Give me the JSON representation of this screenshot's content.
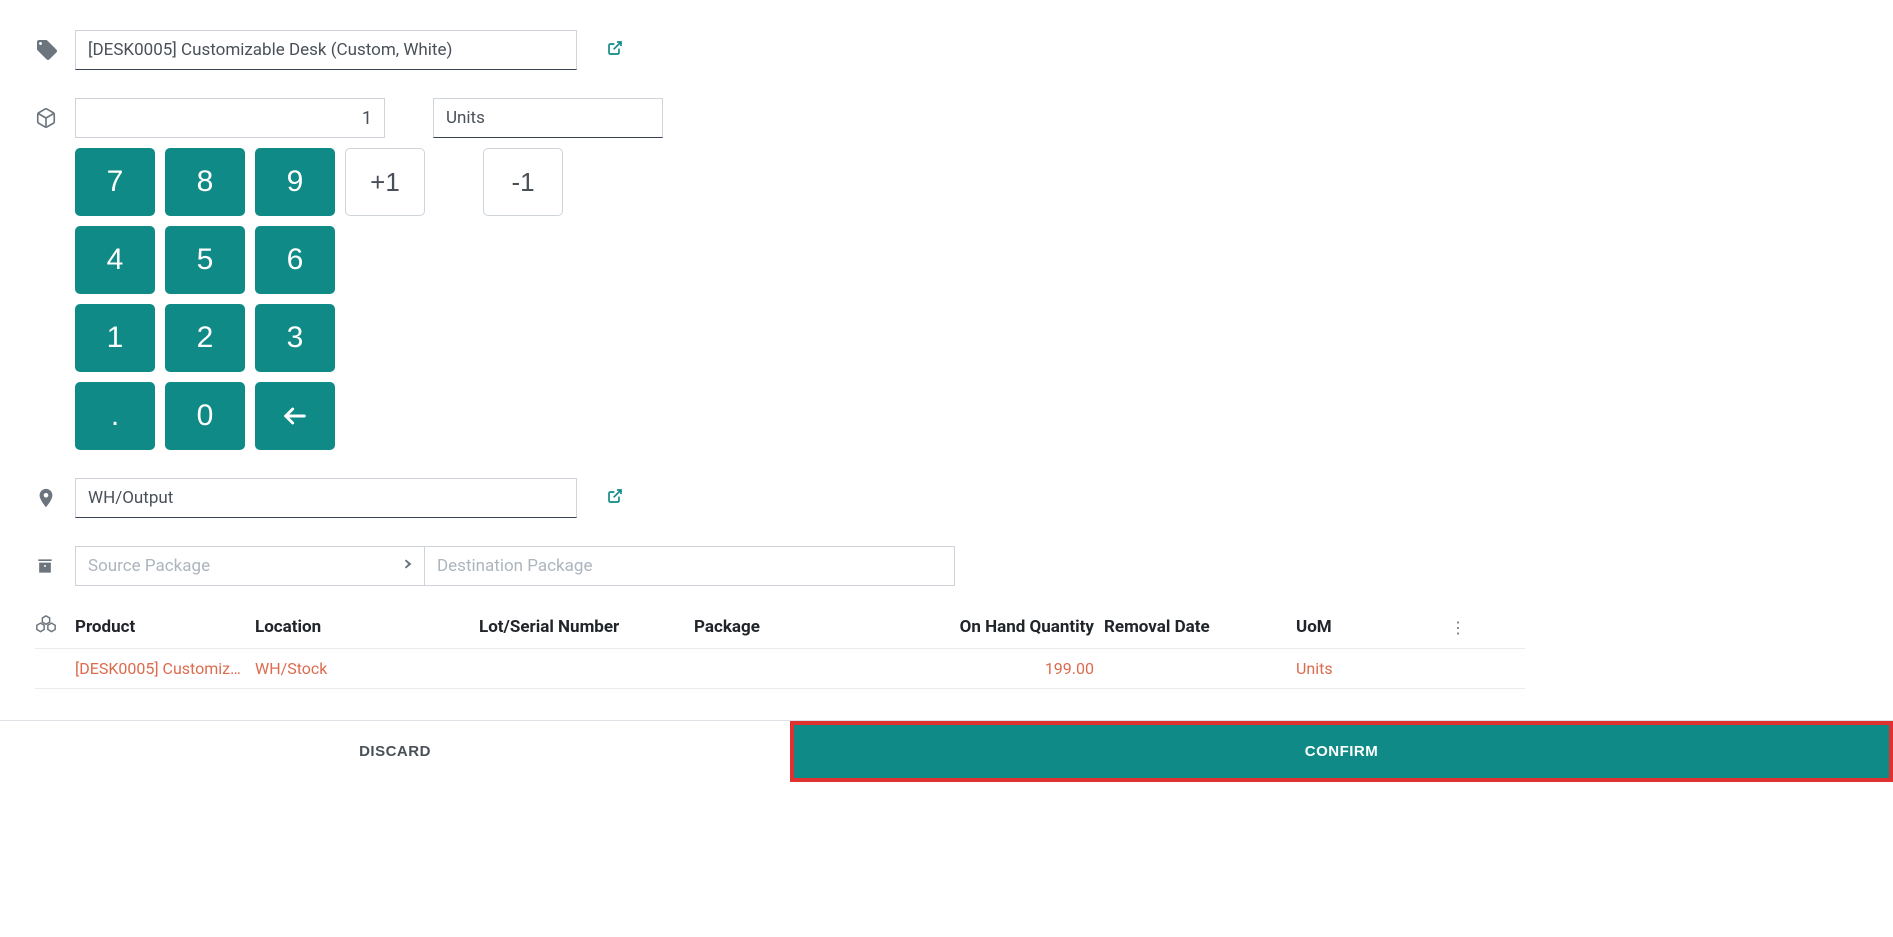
{
  "product": {
    "name": "[DESK0005] Customizable Desk (Custom, White)"
  },
  "quantity": {
    "value": "1",
    "uom": "Units"
  },
  "keypad": {
    "k7": "7",
    "k8": "8",
    "k9": "9",
    "k4": "4",
    "k5": "5",
    "k6": "6",
    "k1": "1",
    "k2": "2",
    "k3": "3",
    "kdot": ".",
    "k0": "0",
    "plus1": "+1",
    "minus1": "-1"
  },
  "location": {
    "value": "WH/Output"
  },
  "package": {
    "src_placeholder": "Source Package",
    "dest_placeholder": "Destination Package"
  },
  "table": {
    "headers": {
      "product": "Product",
      "location": "Location",
      "lot": "Lot/Serial Number",
      "package": "Package",
      "onhand": "On Hand Quantity",
      "removal": "Removal Date",
      "uom": "UoM"
    },
    "row": {
      "product": "[DESK0005] Customiz…",
      "location": "WH/Stock",
      "lot": "",
      "package": "",
      "onhand": "199.00",
      "removal": "",
      "uom": "Units"
    }
  },
  "footer": {
    "discard": "DISCARD",
    "confirm": "CONFIRM"
  }
}
